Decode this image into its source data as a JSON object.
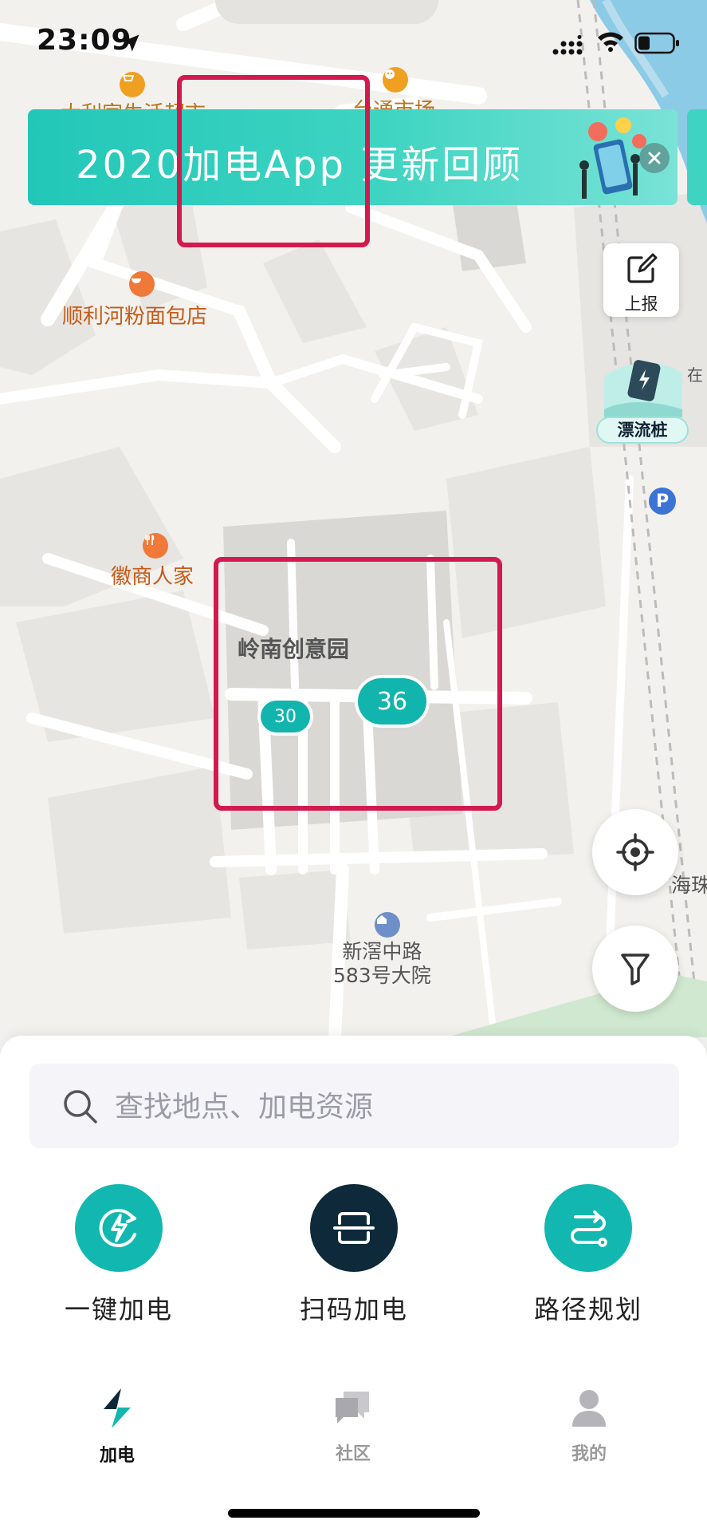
{
  "status_bar": {
    "time": "23:09"
  },
  "banner": {
    "text": "2020加电App 更新回顾"
  },
  "map": {
    "pois": {
      "top_supermarket": "大利家生活超市",
      "market": "台通市场",
      "noodle_shop": "顺利河粉面包店",
      "restaurant": "徽商人家",
      "park": "岭南创意园",
      "compound_line1": "新滘中路",
      "compound_line2": "583号大院",
      "right_edge_1": "海珠",
      "right_edge_2": "在"
    },
    "clusters": [
      {
        "count": "30"
      },
      {
        "count": "36"
      }
    ]
  },
  "side_controls": {
    "report_label": "上报",
    "drift_label": "漂流桩"
  },
  "search": {
    "placeholder": "查找地点、加电资源"
  },
  "actions": [
    {
      "label": "一键加电",
      "icon": "lightning-cycle-icon",
      "color": "#12b8b0"
    },
    {
      "label": "扫码加电",
      "icon": "scan-icon",
      "color": "#0e2a3a"
    },
    {
      "label": "路径规划",
      "icon": "route-icon",
      "color": "#12b8b0"
    }
  ],
  "tabs": [
    {
      "label": "加电",
      "icon": "lightning-icon",
      "active": true
    },
    {
      "label": "社区",
      "icon": "chat-icon",
      "active": false
    },
    {
      "label": "我的",
      "icon": "person-icon",
      "active": false
    }
  ],
  "colors": {
    "accent": "#12b8b0",
    "dark": "#0e2a3a",
    "annotation": "#d31a4f"
  }
}
